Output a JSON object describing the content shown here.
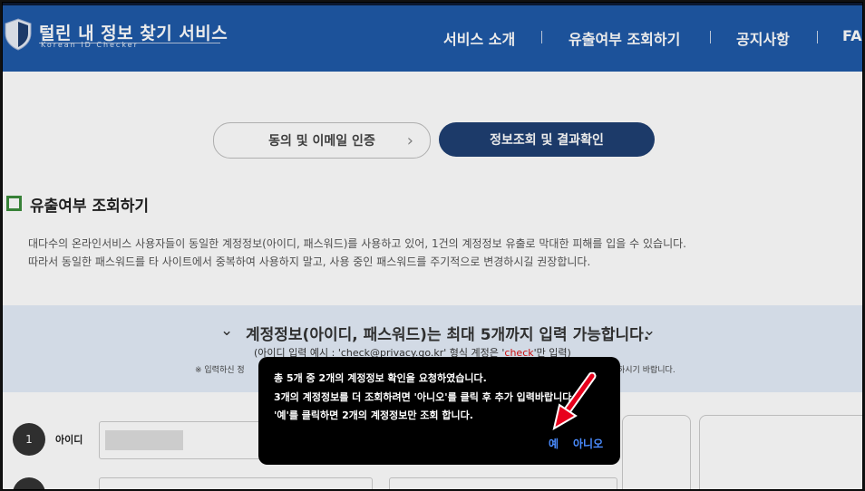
{
  "header": {
    "brand_title": "털린 내 정보 찾기 서비스",
    "brand_subtitle": "Korean ID Checker",
    "nav": [
      "서비스 소개",
      "유출여부 조회하기",
      "공지사항",
      "FA"
    ]
  },
  "steps": {
    "step1": "동의 및 이메일 인증",
    "step2": "정보조회 및 결과확인"
  },
  "section": {
    "title": "유출여부 조회하기",
    "desc_line1": "대다수의 온라인서비스 사용자들이 동일한 계정정보(아이디, 패스워드)를 사용하고 있어, 1건의 계정정보 유출로 막대한 피해를 입을 수 있습니다.",
    "desc_line2": "따라서 동일한 패스워드를 타 사이트에서 중복하여 사용하지 말고, 사용 중인 패스워드를 주기적으로 변경하시길 권장합니다."
  },
  "info_box": {
    "heading": "계정정보(아이디, 패스워드)는 최대 5개까지 입력 가능합니다.",
    "example_prefix": "(아이디 입력 예시 : 'check@privacy.go.kr' 형식 계정은 '",
    "example_highlight": "check",
    "example_suffix": "'만 입력)",
    "note_head": "※ 입력하신 정",
    "note_tail": "하시기 바랍니다."
  },
  "form": {
    "row1_number": "1",
    "id_label": "아이디"
  },
  "dialog": {
    "line1": "총 5개 중 2개의 계정정보 확인을 요청하였습니다.",
    "line2": "3개의 계정정보를 더 조회하려면 '아니오'를 클릭 후 추가 입력바랍니다.",
    "line3": "'예'를 클릭하면 2개의 계정정보만 조회 합니다.",
    "yes": "예",
    "no": "아니오"
  },
  "colors": {
    "header_bg": "#1f5aa8",
    "active_step_bg": "#1f3f72",
    "dialog_bg": "#000000",
    "dialog_button": "#4a8cff",
    "arrow": "#e8001c",
    "section_icon": "#3c8c3c",
    "info_bg": "#e4edf9"
  },
  "icons": {
    "logo": "shield-icon",
    "step_chevron": "chevron-right-icon",
    "heading_chevrons": "chevron-down-icon",
    "pointer": "red-arrow-icon"
  }
}
